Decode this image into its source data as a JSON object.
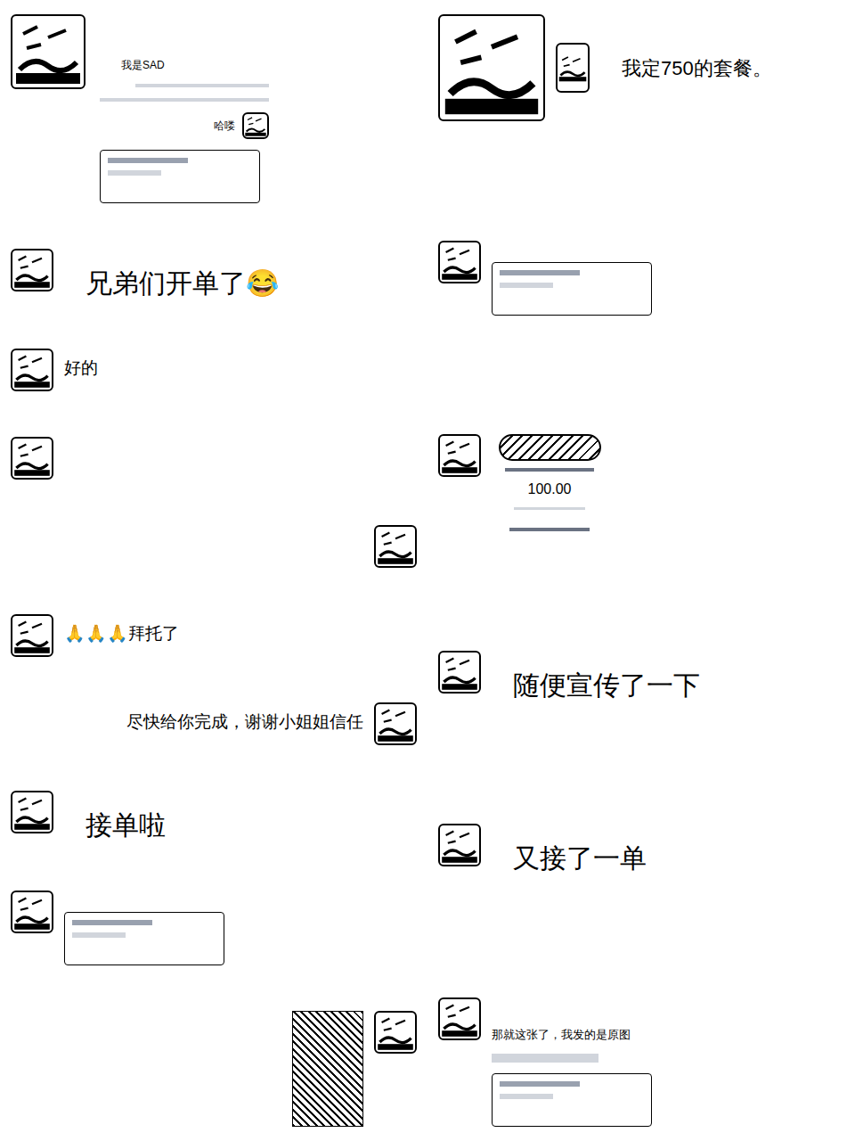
{
  "left": [
    {
      "kind": "intro",
      "side": "left",
      "text": "我是SAD",
      "reply": "哈喽"
    },
    {
      "kind": "headline",
      "side": "left",
      "text": "兄弟们开单了😂"
    },
    {
      "kind": "text",
      "side": "left",
      "text": "好的"
    },
    {
      "kind": "blank",
      "side": "left"
    },
    {
      "kind": "blank",
      "side": "right"
    },
    {
      "kind": "text",
      "side": "left",
      "text": "🙏🙏🙏拜托了"
    },
    {
      "kind": "text",
      "side": "right",
      "text": "尽快给你完成，谢谢小姐姐信任"
    },
    {
      "kind": "headline",
      "side": "left",
      "text": "接单啦"
    },
    {
      "kind": "card",
      "side": "left"
    },
    {
      "kind": "image",
      "side": "right"
    }
  ],
  "right": [
    {
      "kind": "header",
      "side": "left",
      "text": "我定750的套餐。"
    },
    {
      "kind": "card",
      "side": "left"
    },
    {
      "kind": "payment",
      "side": "left",
      "amount": "100.00"
    },
    {
      "kind": "headline",
      "side": "left",
      "text": "随便宣传了一下"
    },
    {
      "kind": "headline",
      "side": "left",
      "text": "又接了一单"
    },
    {
      "kind": "note",
      "side": "left",
      "text": "那就这张了，我发的是原图"
    }
  ]
}
